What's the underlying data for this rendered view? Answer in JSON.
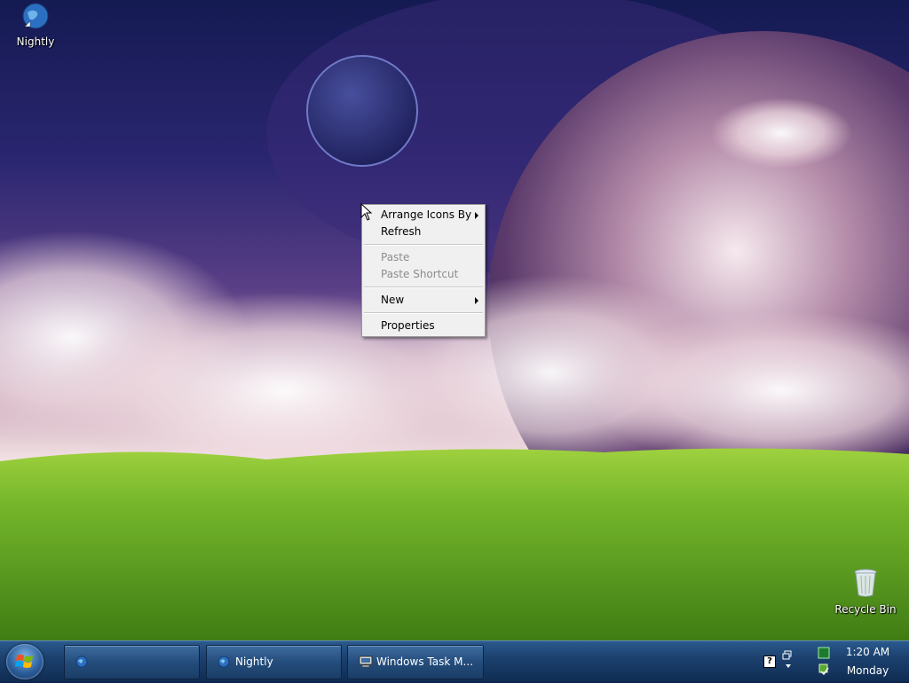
{
  "desktop": {
    "icons": [
      {
        "label": "Nightly",
        "icon": "globe-icon"
      },
      {
        "label": "Recycle Bin",
        "icon": "recycle-bin-icon"
      }
    ]
  },
  "context_menu": {
    "items": [
      {
        "label": "Arrange Icons By",
        "enabled": true,
        "submenu": true
      },
      {
        "label": "Refresh",
        "enabled": true,
        "submenu": false
      },
      {
        "label": "Paste",
        "enabled": false,
        "submenu": false
      },
      {
        "label": "Paste Shortcut",
        "enabled": false,
        "submenu": false
      },
      {
        "label": "New",
        "enabled": true,
        "submenu": true
      },
      {
        "label": "Properties",
        "enabled": true,
        "submenu": false
      }
    ]
  },
  "taskbar": {
    "start_icon": "windows-logo-icon",
    "tasks": [
      {
        "label": "",
        "icon": "globe-icon"
      },
      {
        "label": "Nightly",
        "icon": "globe-icon"
      },
      {
        "label": "Windows Task M...",
        "icon": "computer-icon"
      }
    ],
    "tray": {
      "help_glyph": "?",
      "time": "1:20 AM",
      "day": "Monday"
    }
  },
  "colors": {
    "taskbar": "#1c416e",
    "menu_background": "#f0f0f0",
    "menu_disabled_text": "#8d8d8d",
    "grass": "#6fae2a",
    "sky": "#2a2670"
  }
}
